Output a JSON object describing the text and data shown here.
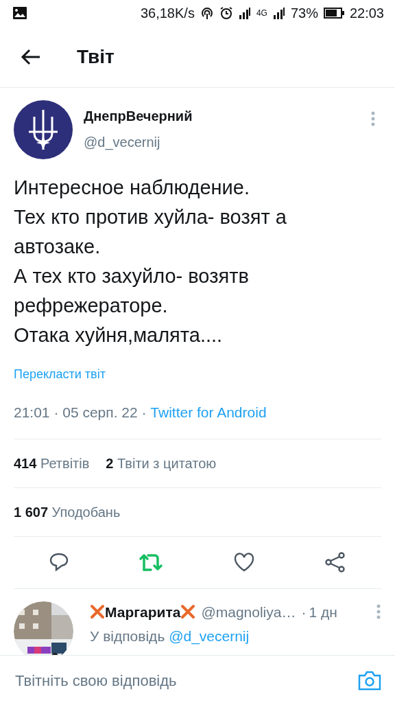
{
  "status_bar": {
    "network_speed": "36,18K/s",
    "network_type": "4G",
    "battery": "73%",
    "time": "22:03"
  },
  "header": {
    "title": "Твіт"
  },
  "tweet": {
    "author": {
      "name": "ДнепрВечерний",
      "handle": "@d_vecernij"
    },
    "text": "Интересное наблюдение.\nТех кто против хуйла- возят а\nавтозаке.\nА тех кто захуйло- возятв\nрефрежераторе.\nОтака хуйня,малята....",
    "translate": "Перекласти твіт",
    "meta": "21:01 · 05 серп. 22 · ",
    "source": "Twitter for Android",
    "stats": [
      {
        "count": "414",
        "label": "Ретвітів"
      },
      {
        "count": "2",
        "label": "Твіти з цитатою"
      }
    ],
    "likes": {
      "count": "1 607",
      "label": "Уподобань"
    },
    "retweeted": true,
    "liked": false
  },
  "reply": {
    "name": "Маргарита",
    "handle": "@magnoliya…",
    "separator": "·",
    "time": "1 дн",
    "replying_to": "У відповідь",
    "mention": "@d_vecernij"
  },
  "compose": {
    "placeholder": "Твітніть свою відповідь"
  }
}
